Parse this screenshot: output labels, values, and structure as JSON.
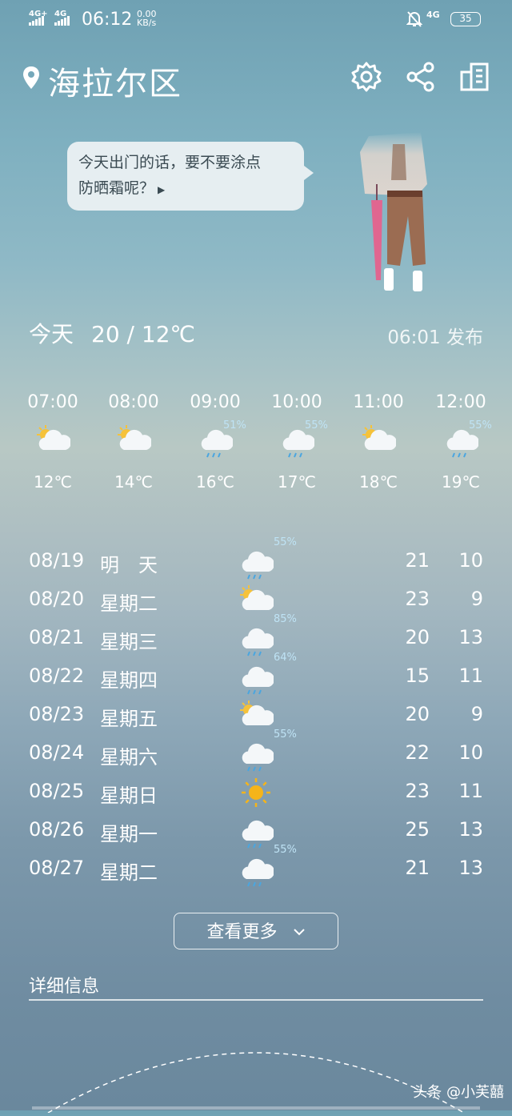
{
  "status": {
    "net1": "4G+",
    "net2": "4G",
    "time": "06:12",
    "speed_top": "0.00",
    "speed_unit": "KB/s",
    "right_net": "4G",
    "battery": "35"
  },
  "header": {
    "location": "海拉尔区"
  },
  "bubble": {
    "line1": "今天出门的话，要不要涂点",
    "line2": "防晒霜呢？"
  },
  "today": {
    "label": "今天",
    "temps": "20 / 12℃",
    "published": "06:01 发布"
  },
  "hourly": [
    {
      "time": "07:00",
      "icon": "partly-cloudy-icon",
      "temp": "12℃",
      "pct": ""
    },
    {
      "time": "08:00",
      "icon": "partly-cloudy-icon",
      "temp": "14℃",
      "pct": ""
    },
    {
      "time": "09:00",
      "icon": "rain-cloud-icon",
      "temp": "16℃",
      "pct": "51%"
    },
    {
      "time": "10:00",
      "icon": "rain-cloud-icon",
      "temp": "17℃",
      "pct": "55%"
    },
    {
      "time": "11:00",
      "icon": "partly-cloudy-icon",
      "temp": "18℃",
      "pct": ""
    },
    {
      "time": "12:00",
      "icon": "rain-cloud-icon",
      "temp": "19℃",
      "pct": "55%"
    }
  ],
  "daily": [
    {
      "date": "08/19",
      "week": "明　天",
      "icon": "rain-cloud-icon",
      "pct": "55%",
      "hi": "21",
      "lo": "10"
    },
    {
      "date": "08/20",
      "week": "星期二",
      "icon": "partly-cloudy-icon",
      "pct": "",
      "hi": "23",
      "lo": "9"
    },
    {
      "date": "08/21",
      "week": "星期三",
      "icon": "rain-cloud-icon",
      "pct": "85%",
      "hi": "20",
      "lo": "13"
    },
    {
      "date": "08/22",
      "week": "星期四",
      "icon": "rain-cloud-icon",
      "pct": "64%",
      "hi": "15",
      "lo": "11"
    },
    {
      "date": "08/23",
      "week": "星期五",
      "icon": "partly-cloudy-icon",
      "pct": "",
      "hi": "20",
      "lo": "9"
    },
    {
      "date": "08/24",
      "week": "星期六",
      "icon": "rain-cloud-icon",
      "pct": "55%",
      "hi": "22",
      "lo": "10"
    },
    {
      "date": "08/25",
      "week": "星期日",
      "icon": "sun-icon",
      "pct": "",
      "hi": "23",
      "lo": "11"
    },
    {
      "date": "08/26",
      "week": "星期一",
      "icon": "rain-cloud-icon",
      "pct": "",
      "hi": "25",
      "lo": "13"
    },
    {
      "date": "08/27",
      "week": "星期二",
      "icon": "rain-cloud-icon",
      "pct": "55%",
      "hi": "21",
      "lo": "13"
    }
  ],
  "more_button": "查看更多",
  "detail_title": "详细信息",
  "watermark": "头条 @小芙囍"
}
